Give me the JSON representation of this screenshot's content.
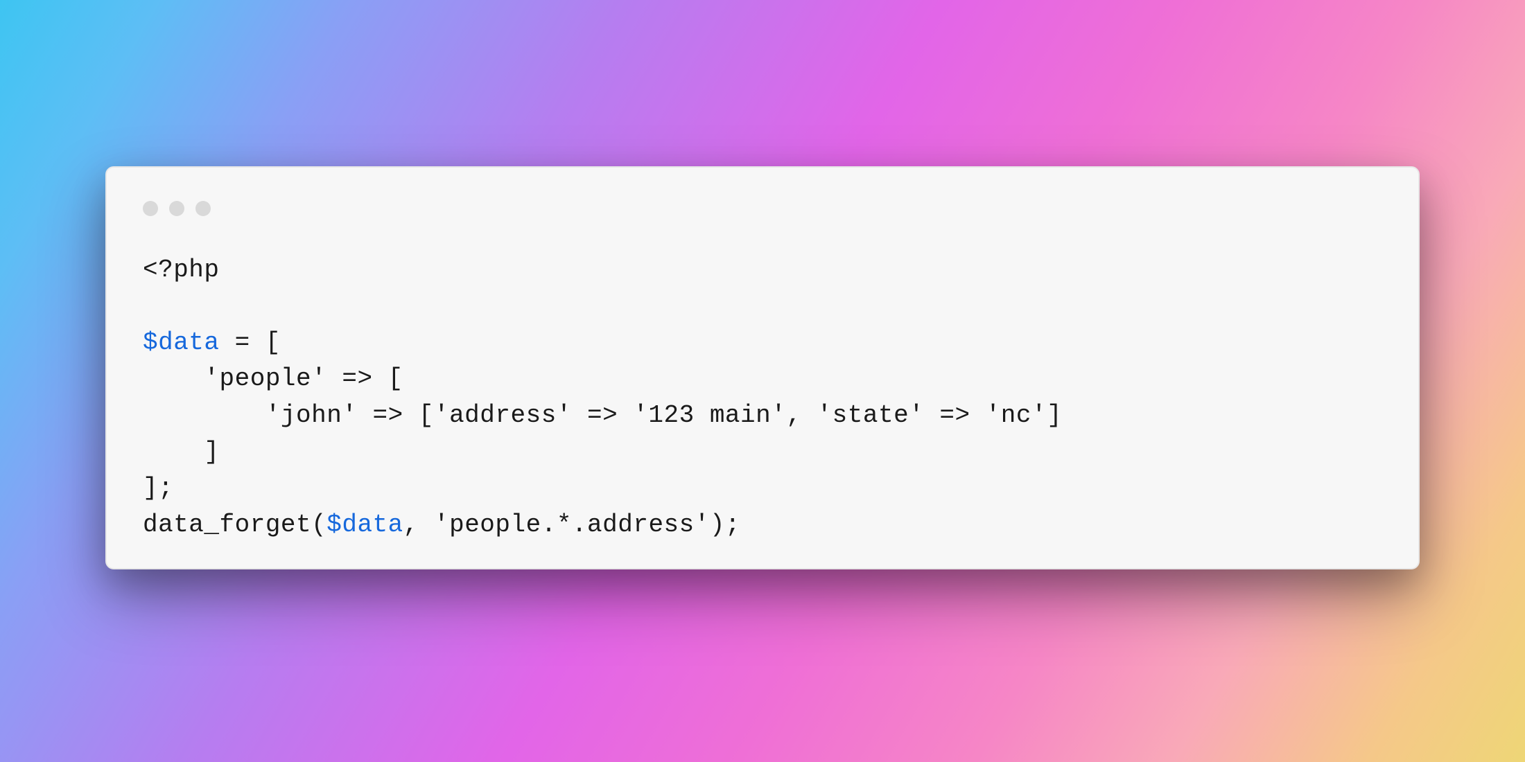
{
  "code": {
    "line1": "<?php",
    "line2": "",
    "line3_var": "$data",
    "line3_rest": " = [",
    "line4": "    'people' => [",
    "line5": "        'john' => ['address' => '123 main', 'state' => 'nc']",
    "line6": "    ]",
    "line7": "];",
    "line8_pre": "data_forget(",
    "line8_var": "$data",
    "line8_post": ", 'people.*.address');"
  }
}
